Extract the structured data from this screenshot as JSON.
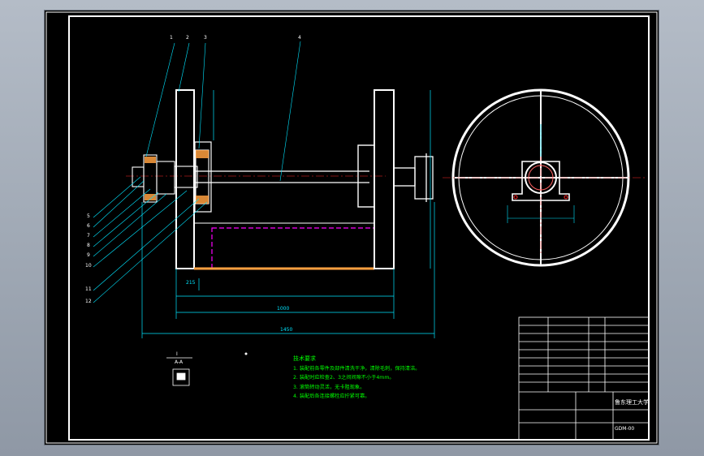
{
  "drawing": {
    "part_labels": [
      "1",
      "2",
      "3",
      "4",
      "5",
      "6",
      "7",
      "8",
      "9",
      "10",
      "11",
      "12"
    ],
    "dimensions": [
      "215",
      "1000",
      "1450"
    ],
    "section_label": "I",
    "section_sub": "A-A"
  },
  "notes": {
    "title": "技术要求",
    "items": [
      "1. 装配前各零件及部件清洗干净，清除毛刺，保持清洁。",
      "2. 装配时应检查2、3之间间隙不小于4mm。",
      "3. 滚筒转动灵活，无卡阻现象。",
      "4. 装配后各连接螺栓应拧紧可靠。"
    ]
  },
  "title_block": {
    "school": "鲁东理工大学",
    "drawing_no": "GDM-00"
  },
  "colors": {
    "outline": "#ffffff",
    "dimension": "#00e5ff",
    "hidden": "#ff00ff",
    "center": "#ff2a2a",
    "section": "#ffa040",
    "notes": "#00ff00"
  }
}
